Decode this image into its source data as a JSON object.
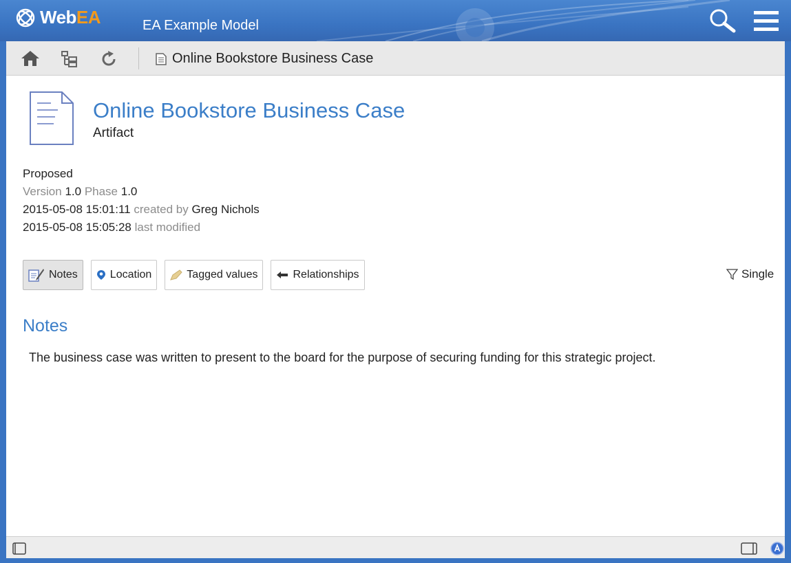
{
  "app": {
    "logo_text_web": "Web",
    "logo_text_ea": "EA",
    "model_name": "EA Example Model"
  },
  "toolbar": {
    "breadcrumb": "Online Bookstore Business Case"
  },
  "element": {
    "title": "Online Bookstore Business Case",
    "type": "Artifact",
    "status": "Proposed",
    "version_label": "Version",
    "version": "1.0",
    "phase_label": "Phase",
    "phase": "1.0",
    "created_date": "2015-05-08 15:01:11",
    "created_by_label": "created by",
    "author": "Greg Nichols",
    "modified_date": "2015-05-08 15:05:28",
    "modified_label": "last modified"
  },
  "tabs": [
    {
      "label": "Notes",
      "icon": "notes-icon",
      "active": true
    },
    {
      "label": "Location",
      "icon": "location-icon",
      "active": false
    },
    {
      "label": "Tagged values",
      "icon": "tag-icon",
      "active": false
    },
    {
      "label": "Relationships",
      "icon": "arrow-left-icon",
      "active": false
    }
  ],
  "filter": {
    "label": "Single"
  },
  "notes": {
    "heading": "Notes",
    "text": "The business case was written to present to the board for the purpose of securing funding for this strategic project."
  },
  "colors": {
    "header_blue": "#3a74c2",
    "title_blue": "#3b7ec8",
    "ea_orange": "#f29a1c"
  }
}
